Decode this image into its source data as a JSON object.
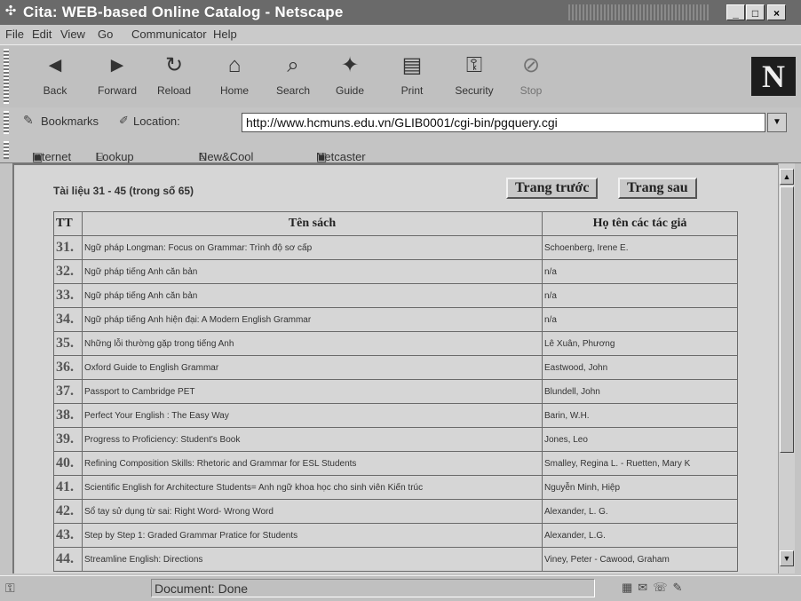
{
  "window": {
    "title": "Cita: WEB-based Online Catalog - Netscape"
  },
  "menu": [
    "File",
    "Edit",
    "View",
    "Go",
    "Communicator",
    "Help"
  ],
  "toolbar": [
    {
      "label": "Back",
      "icon": "back-arrow-icon",
      "glyph": "◄"
    },
    {
      "label": "Forward",
      "icon": "forward-arrow-icon",
      "glyph": "►"
    },
    {
      "label": "Reload",
      "icon": "reload-icon",
      "glyph": "↻"
    },
    {
      "label": "Home",
      "icon": "home-icon",
      "glyph": "⌂"
    },
    {
      "label": "Search",
      "icon": "search-icon",
      "glyph": "⌕"
    },
    {
      "label": "Guide",
      "icon": "guide-icon",
      "glyph": "✦"
    },
    {
      "label": "Print",
      "icon": "print-icon",
      "glyph": "▤"
    },
    {
      "label": "Security",
      "icon": "security-icon",
      "glyph": "⚿"
    },
    {
      "label": "Stop",
      "icon": "stop-icon",
      "glyph": "⊘"
    }
  ],
  "location": {
    "bookmarks": "Bookmarks",
    "label": "Location:",
    "url": "http://www.hcmuns.edu.vn/GLIB0001/cgi-bin/pgquery.cgi"
  },
  "personal_bar": [
    "Internet",
    "Lookup",
    "New&Cool",
    "Netcaster"
  ],
  "page": {
    "range_text": "Tài liệu 31 - 45 (trong số 65)",
    "prev_button": "Trang trước",
    "next_button": "Trang sau",
    "headers": {
      "num": "TT",
      "title": "Tên sách",
      "authors": "Họ tên các tác giả"
    },
    "rows": [
      {
        "n": "31.",
        "title": "Ngữ pháp Longman: Focus on Grammar: Trình độ sơ cấp",
        "author": "Schoenberg, Irene E."
      },
      {
        "n": "32.",
        "title": "Ngữ pháp tiếng Anh căn bản",
        "author": "n/a"
      },
      {
        "n": "33.",
        "title": "Ngữ pháp tiếng Anh căn bản",
        "author": "n/a"
      },
      {
        "n": "34.",
        "title": "Ngữ pháp tiếng Anh hiện đại: A Modern English Grammar",
        "author": "n/a"
      },
      {
        "n": "35.",
        "title": "Những lỗi thường gặp trong tiếng Anh",
        "author": "Lê Xuân, Phương"
      },
      {
        "n": "36.",
        "title": "Oxford Guide to English Grammar",
        "author": "Eastwood, John"
      },
      {
        "n": "37.",
        "title": "Passport to Cambridge PET",
        "author": "Blundell, John"
      },
      {
        "n": "38.",
        "title": "Perfect Your English : The Easy Way",
        "author": "Barin, W.H."
      },
      {
        "n": "39.",
        "title": "Progress to Proficiency: Student's Book",
        "author": "Jones, Leo"
      },
      {
        "n": "40.",
        "title": "Refining Composition Skills: Rhetoric and Grammar for ESL Students",
        "author": "Smalley, Regina L. - Ruetten, Mary K"
      },
      {
        "n": "41.",
        "title": "Scientific English for Architecture Students= Anh ngữ khoa học cho sinh viên Kiến trúc",
        "author": "Nguyễn Minh, Hiệp"
      },
      {
        "n": "42.",
        "title": "Sổ tay sử dụng từ sai: Right Word- Wrong Word",
        "author": "Alexander, L. G."
      },
      {
        "n": "43.",
        "title": "Step by Step 1: Graded Grammar Pratice for Students",
        "author": "Alexander, L.G."
      },
      {
        "n": "44.",
        "title": "Streamline English: Directions",
        "author": "Viney, Peter - Cawood, Graham"
      }
    ]
  },
  "status": {
    "text": "Document: Done"
  }
}
